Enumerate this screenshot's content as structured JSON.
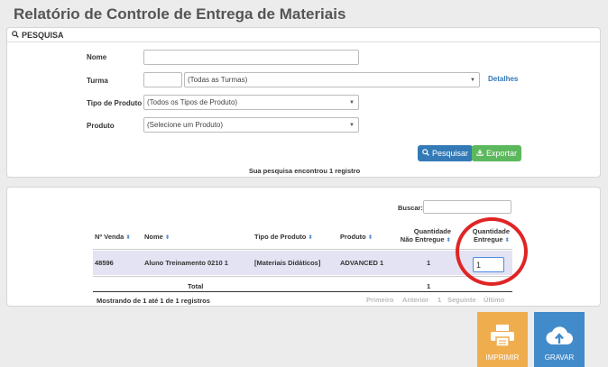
{
  "page": {
    "title": "Relatório de Controle de Entrega de Materiais"
  },
  "search": {
    "heading": "PESQUISA",
    "nome_label": "Nome",
    "nome_value": "",
    "turma_label": "Turma",
    "turma_code": "",
    "turma_select": "(Todas as Turmas)",
    "detalhes_link": "Detalhes",
    "tipo_label": "Tipo de Produto",
    "tipo_select": "(Todos os Tipos de Produto)",
    "produto_label": "Produto",
    "produto_select": "(Selecione um Produto)",
    "pesquisar_button": "Pesquisar",
    "exportar_button": "Exportar",
    "result_message": "Sua pesquisa encontrou 1 registro"
  },
  "results": {
    "buscar_label": "Buscar:",
    "buscar_value": "",
    "columns": {
      "venda": "Nº Venda",
      "nome": "Nome",
      "tipo": "Tipo de Produto",
      "produto": "Produto",
      "nao_entregue_1": "Quantidade",
      "nao_entregue_2": "Não Entregue",
      "entregue_1": "Quantidade",
      "entregue_2": "Entregue"
    },
    "rows": [
      {
        "venda": "48596",
        "nome": "Aluno Treinamento 0210 1",
        "tipo": "[Materiais Didáticos]",
        "produto": "ADVANCED 1",
        "nao_entregue": "1",
        "entregue": "1"
      }
    ],
    "total_label": "Total",
    "total_value": "1",
    "info": "Mostrando de 1 até 1 de 1 registros",
    "pager": {
      "first": "Primeiro",
      "prev": "Anterior",
      "page": "1",
      "next": "Seguinte",
      "last": "Último"
    }
  },
  "actions": {
    "print_label": "IMPRIMIR",
    "save_label": "GRAVAR"
  },
  "colors": {
    "primary": "#337ab7",
    "success": "#5cb85c",
    "warning": "#f0ad4e",
    "info": "#428bca",
    "highlight": "#e02424"
  }
}
